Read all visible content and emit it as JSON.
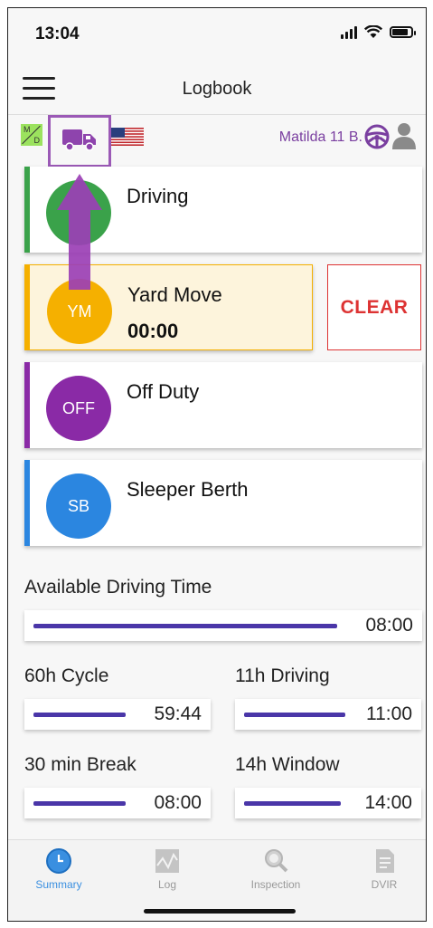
{
  "status_bar": {
    "time": "13:04"
  },
  "header": {
    "title": "Logbook",
    "menu_icon": "hamburger-menu-icon"
  },
  "subbar": {
    "md_icon": {
      "top": "M",
      "bottom": "D"
    },
    "vehicle_icon": "truck-icon",
    "flag_icon": "us-flag-icon",
    "driver_name": "Matilda 11 B.",
    "wheel_icon": "steering-wheel-icon",
    "person_icon": "person-icon"
  },
  "colors": {
    "driving": "#3aa24a",
    "yard_move": "#f5b000",
    "off_duty": "#8a2aa6",
    "sleeper": "#2b86e0",
    "accent": "#9b59b6",
    "timer_bar": "#4a36a8",
    "clear": "#dd3333"
  },
  "statuses": [
    {
      "label": "Driving",
      "badge": ""
    },
    {
      "label": "Yard Move",
      "badge": "YM",
      "time": "00:00"
    },
    {
      "label": "Off Duty",
      "badge": "OFF"
    },
    {
      "label": "Sleeper Berth",
      "badge": "SB"
    }
  ],
  "clear_button": "CLEAR",
  "timers": {
    "available": {
      "label": "Available Driving Time",
      "value": "08:00"
    },
    "cycle60": {
      "label": "60h Cycle",
      "value": "59:44"
    },
    "driving11": {
      "label": "11h Driving",
      "value": "11:00"
    },
    "break30": {
      "label": "30 min Break",
      "value": "08:00"
    },
    "window14": {
      "label": "14h Window",
      "value": "14:00"
    }
  },
  "tabs": [
    {
      "label": "Summary",
      "icon": "clock-icon",
      "active": true
    },
    {
      "label": "Log",
      "icon": "graph-icon",
      "active": false
    },
    {
      "label": "Inspection",
      "icon": "magnifier-icon",
      "active": false
    },
    {
      "label": "DVIR",
      "icon": "document-icon",
      "active": false
    }
  ]
}
